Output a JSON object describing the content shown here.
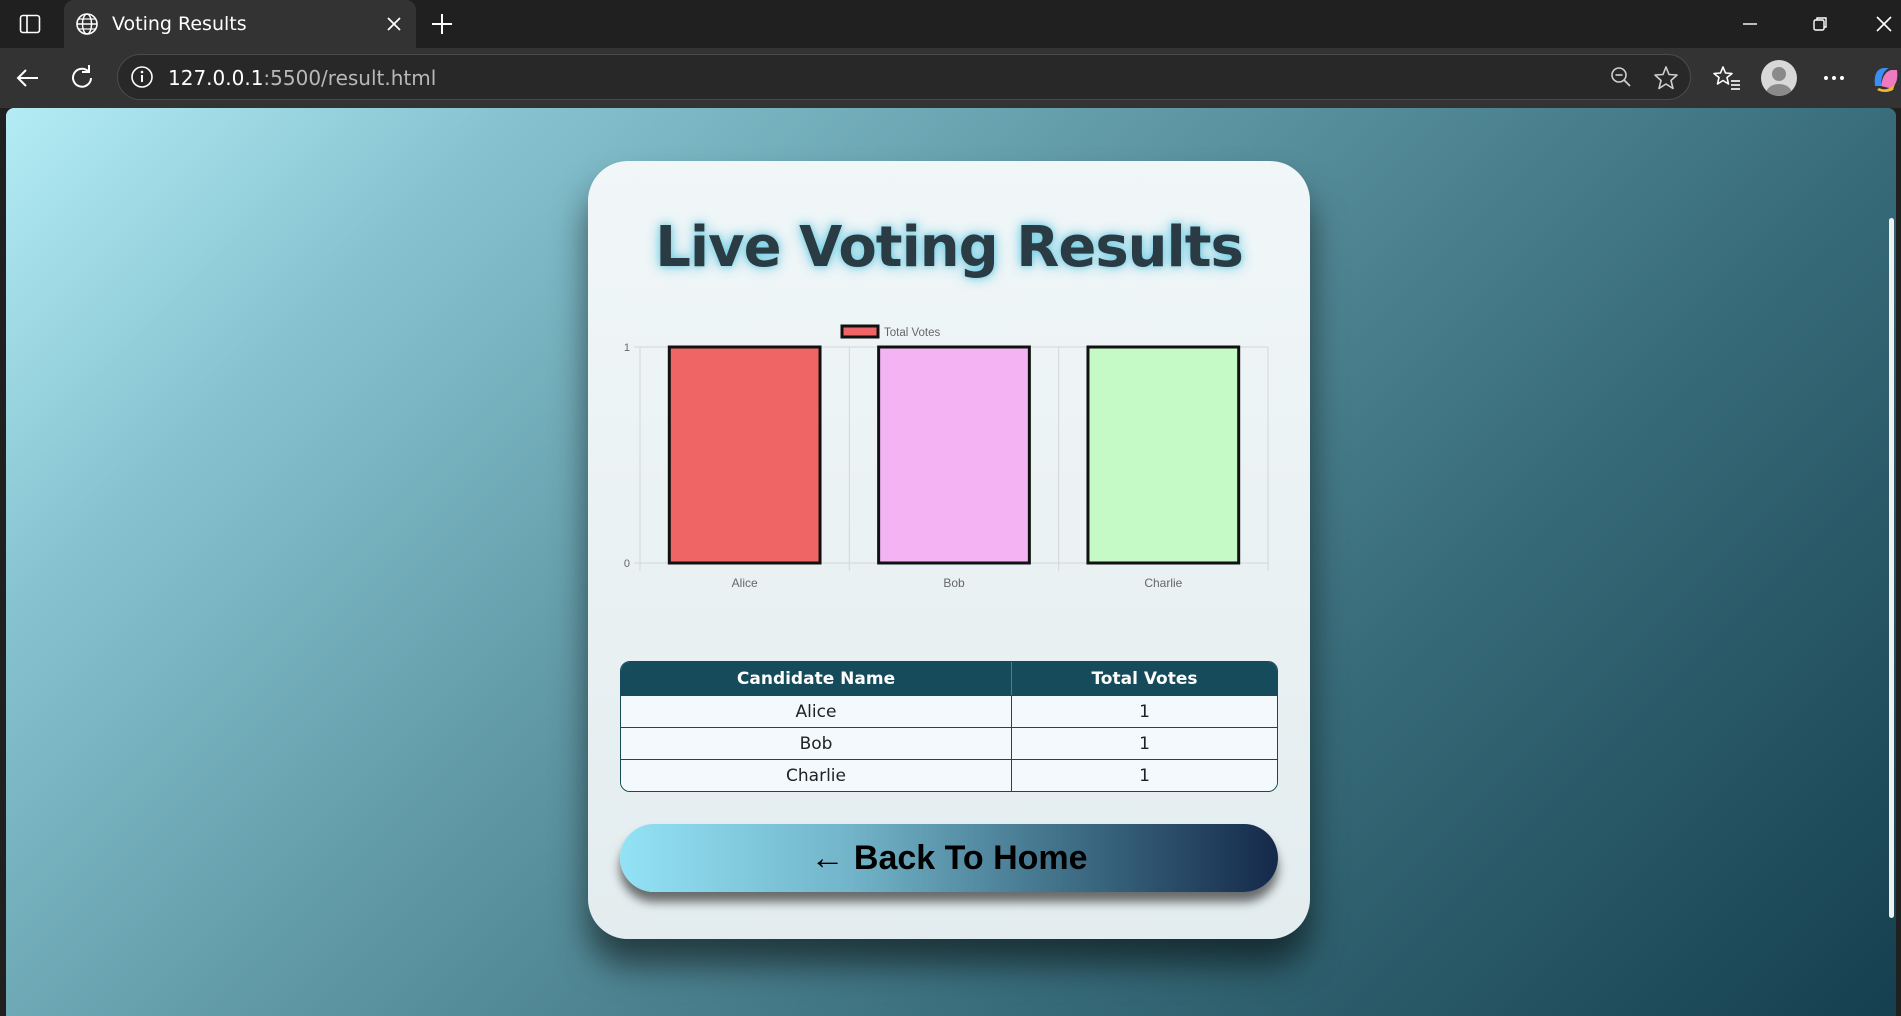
{
  "browser": {
    "tab_title": "Voting Results",
    "url_host": "127.0.0.1",
    "url_path": ":5500/result.html"
  },
  "page": {
    "title": "Live Voting Results",
    "back_button_label": "← Back To Home"
  },
  "chart_data": {
    "type": "bar",
    "categories": [
      "Alice",
      "Bob",
      "Charlie"
    ],
    "series": [
      {
        "name": "Total Votes",
        "values": [
          1,
          1,
          1
        ]
      }
    ],
    "bar_colors": [
      "#ef6565",
      "#f4b4f4",
      "#c5f9c5"
    ],
    "bar_border_color": "#111111",
    "legend_color": "#ef6565",
    "ylim": [
      0,
      1
    ],
    "yticks": [
      "0",
      "1"
    ],
    "grid": true,
    "legend_position": "top"
  },
  "table": {
    "headers": [
      "Candidate Name",
      "Total Votes"
    ],
    "rows": [
      [
        "Alice",
        "1"
      ],
      [
        "Bob",
        "1"
      ],
      [
        "Charlie",
        "1"
      ]
    ]
  }
}
